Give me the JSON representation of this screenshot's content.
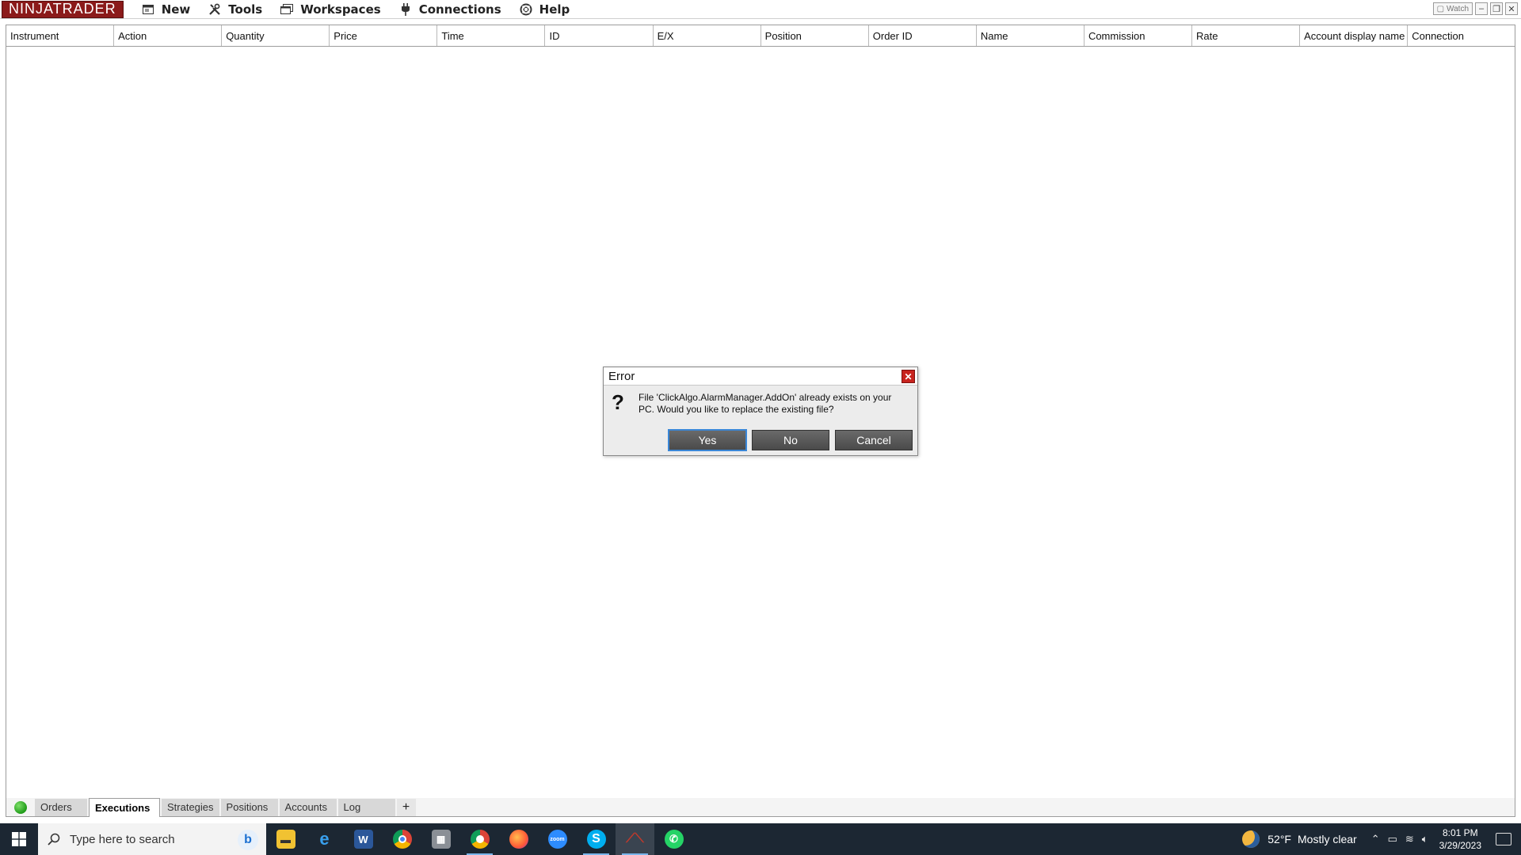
{
  "app": {
    "logo_text": "NINJATRADER",
    "brand_color": "#8b1a1a"
  },
  "menu": [
    {
      "label": "New",
      "icon": "new-window-icon"
    },
    {
      "label": "Tools",
      "icon": "tools-icon"
    },
    {
      "label": "Workspaces",
      "icon": "workspaces-icon"
    },
    {
      "label": "Connections",
      "icon": "connections-plug-icon"
    },
    {
      "label": "Help",
      "icon": "help-lifebuoy-icon"
    }
  ],
  "window_controls": {
    "watch_label": "Watch"
  },
  "grid": {
    "columns": [
      "Instrument",
      "Action",
      "Quantity",
      "Price",
      "Time",
      "ID",
      "E/X",
      "Position",
      "Order ID",
      "Name",
      "Commission",
      "Rate",
      "Account display name",
      "Connection"
    ],
    "rows": []
  },
  "tabs": {
    "items": [
      "Orders",
      "Executions",
      "Strategies",
      "Positions",
      "Accounts",
      "Log"
    ],
    "active": "Executions",
    "add_label": "+",
    "connection_status_color": "#1f9b18"
  },
  "dialog": {
    "title": "Error",
    "message": "File 'ClickAlgo.AlarmManager.AddOn' already exists on your PC. Would you like to replace the existing file?",
    "icon": "question-icon",
    "buttons": {
      "yes": "Yes",
      "no": "No",
      "cancel": "Cancel"
    }
  },
  "taskbar": {
    "search_placeholder": "Type here to search",
    "apps": [
      "file-explorer",
      "internet-explorer",
      "word",
      "chrome",
      "chrome-profile",
      "firefox",
      "zoom",
      "skype",
      "ninjatrader",
      "whatsapp"
    ],
    "weather": {
      "temp": "52°F",
      "condition": "Mostly clear"
    },
    "clock": {
      "time": "8:01 PM",
      "date": "3/29/2023"
    }
  }
}
